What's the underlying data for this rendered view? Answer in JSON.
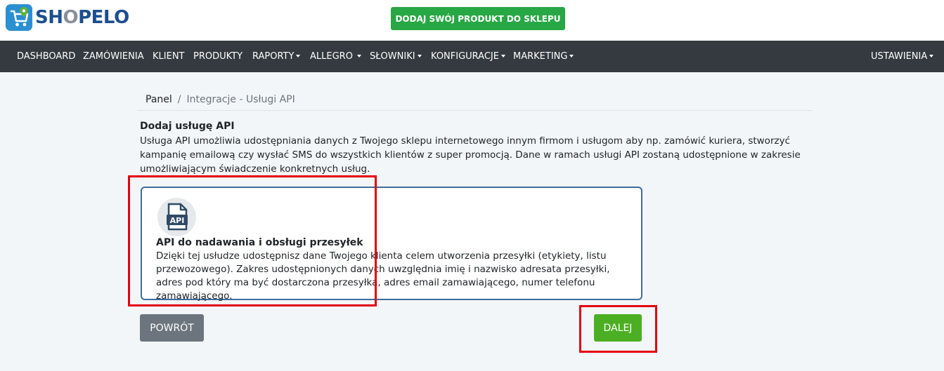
{
  "header": {
    "logo_text_1": "SH",
    "logo_text_2": "O",
    "logo_text_3": "PELO",
    "cta_label": "DODAJ SWÓJ PRODUKT DO SKLEPU"
  },
  "nav": {
    "dashboard": "DASHBOARD",
    "orders": "ZAMÓWIENIA",
    "client": "KLIENT",
    "products": "PRODUKTY",
    "reports": "RAPORTY",
    "allegro": "ALLEGRO",
    "dictionaries": "SŁOWNIKI",
    "configuration": "KONFIGURACJE",
    "marketing": "MARKETING",
    "settings": "USTAWIENIA"
  },
  "breadcrumb": {
    "home": "Panel",
    "separator": "/",
    "current": "Integracje - Usługi API"
  },
  "section": {
    "title": "Dodaj usługę API",
    "description": "Usługa API umożliwia udostępniania danych z Twojego sklepu internetowego innym firmom i usługom aby np. zamówić kuriera, stworzyć kampanię emailową czy wysłać SMS do wszystkich klientów z super promocją. Dane w ramach usługi API zostaną udostępnione w zakresie umożliwiającym świadczenie konkretnych usług."
  },
  "service_card": {
    "icon": "api-document-icon",
    "icon_label": "API",
    "title": "API do nadawania i obsługi przesyłek",
    "description": "Dzięki tej usłudze udostępnisz dane Twojego klienta celem utworzenia przesyłki (etykiety, listu przewozowego). Zakres udostępnionych danych uwzględnia imię i nazwisko adresata przesyłki, adres pod który ma być dostarczona przesyłka, adres email zamawiającego, numer telefonu zamawiającego."
  },
  "buttons": {
    "back": "POWRÓT",
    "next": "DALEJ"
  },
  "colors": {
    "navbar": "#343a40",
    "primary_green": "#28a745",
    "next_green": "#4caf23",
    "card_border": "#3e6d9c",
    "highlight_red": "#e3000f",
    "logo_blue": "#1d4e8f"
  }
}
